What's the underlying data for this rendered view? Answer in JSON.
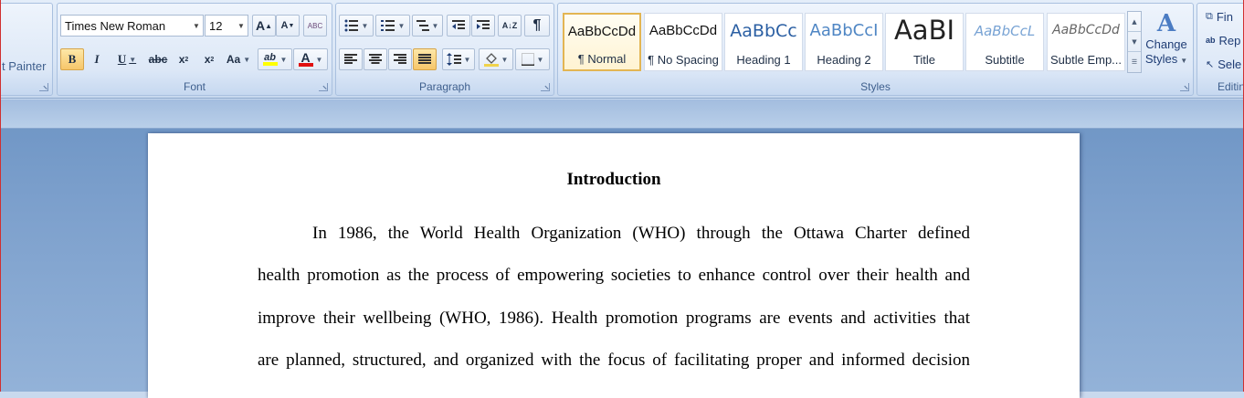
{
  "window": {
    "title_color": "#ffffff"
  },
  "clipboard": {
    "format_painter_label": "t Painter"
  },
  "font": {
    "group_label": "Font",
    "font_name": "Times New Roman",
    "font_size": "12",
    "grow_label": "A",
    "shrink_label": "A",
    "clear_label": "ABC",
    "bold_label": "B",
    "italic_label": "I",
    "underline_label": "U",
    "strike_label": "abc",
    "subscript_label": "x",
    "superscript_label": "x",
    "case_label": "Aa",
    "highlight_label": "ab",
    "color_label": "A",
    "highlight_color": "#ffff00",
    "font_color": "#e01010"
  },
  "paragraph": {
    "group_label": "Paragraph",
    "show_marks_label": "¶"
  },
  "styles": {
    "group_label": "Styles",
    "tiles": [
      {
        "sample": "AaBbCcDd",
        "name": "¶ Normal",
        "selected": true
      },
      {
        "sample": "AaBbCcDd",
        "name": "¶ No Spacing"
      },
      {
        "sample": "AaBbCc",
        "name": "Heading 1"
      },
      {
        "sample": "AaBbCcI",
        "name": "Heading 2"
      },
      {
        "sample": "AaBI",
        "name": "Title"
      },
      {
        "sample": "AaBbCcL",
        "name": "Subtitle"
      },
      {
        "sample": "AaBbCcDd",
        "name": "Subtle Emp..."
      }
    ],
    "change_styles_line1": "Change",
    "change_styles_line2": "Styles"
  },
  "editing": {
    "group_label": "Editin",
    "find_label": "Fin",
    "replace_label": "Rep",
    "select_label": "Sele"
  },
  "document": {
    "heading": "Introduction",
    "lines": [
      "In 1986, the World Health Organization (WHO) through the Ottawa Charter defined",
      "health promotion as the process of empowering societies to enhance control over their health and",
      "improve their wellbeing (WHO, 1986). Health promotion programs are events and activities that",
      "are planned, structured, and organized with the focus of facilitating proper and informed decision"
    ]
  }
}
